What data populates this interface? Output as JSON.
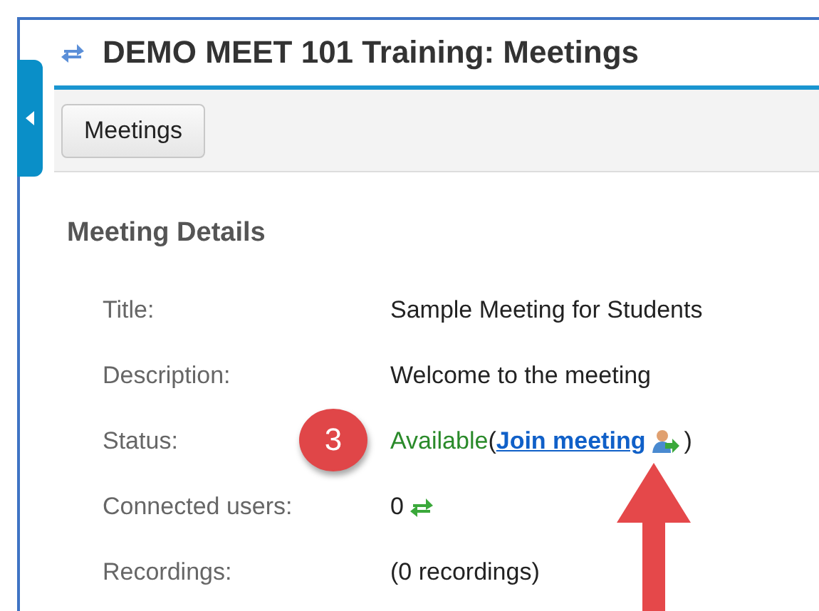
{
  "window": {
    "title": "DEMO MEET 101 Training: Meetings"
  },
  "toolbar": {
    "buttons": [
      "Meetings"
    ]
  },
  "section": {
    "heading": "Meeting Details"
  },
  "details": [
    {
      "kind": "text",
      "label": "Title:",
      "value": "Sample Meeting for Students"
    },
    {
      "kind": "text",
      "label": "Description:",
      "value": "Welcome to the meeting"
    },
    {
      "kind": "status",
      "label": "Status:",
      "value": "Available",
      "open": "(",
      "link": "Join meeting",
      "close": ")",
      "badge": "3"
    },
    {
      "kind": "count",
      "label": "Connected users:",
      "value": "0"
    },
    {
      "kind": "text",
      "label": "Recordings:",
      "value": "(0 recordings)"
    }
  ]
}
